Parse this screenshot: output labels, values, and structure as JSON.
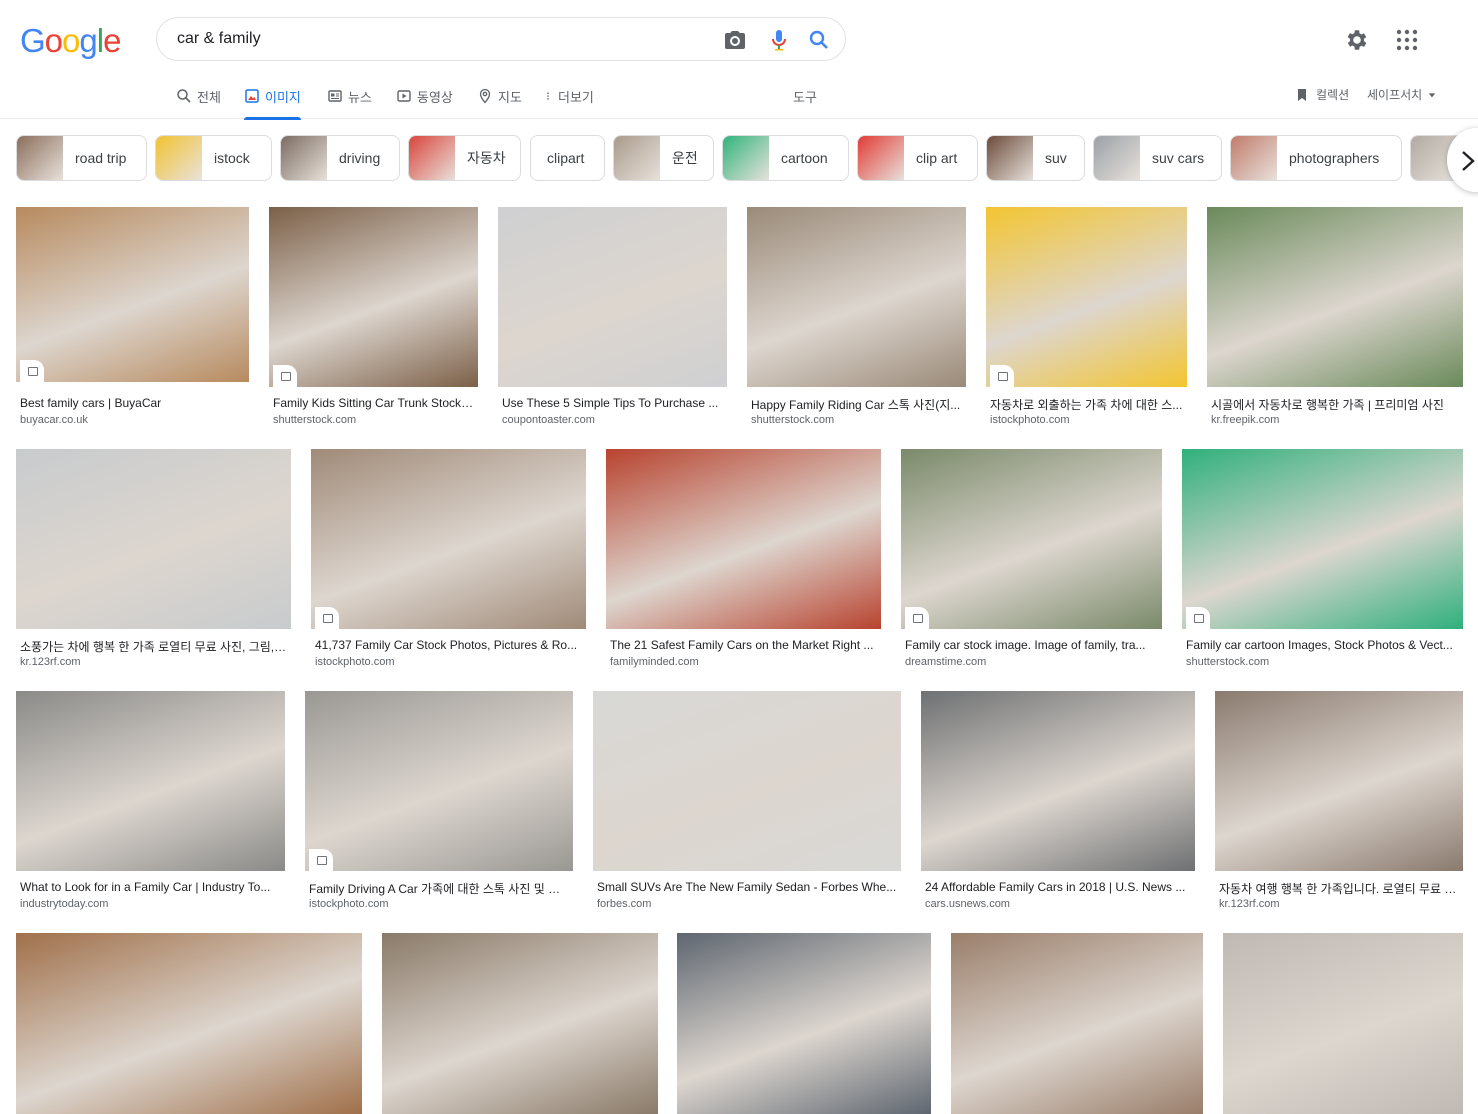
{
  "logo": {
    "g1": "G",
    "o1": "o",
    "o2": "o",
    "g2": "g",
    "l": "l",
    "e": "e"
  },
  "search": {
    "query": "car & family"
  },
  "tabs": [
    {
      "label": "전체",
      "icon": "search-icon"
    },
    {
      "label": "이미지",
      "icon": "image-icon",
      "active": true
    },
    {
      "label": "뉴스",
      "icon": "news-icon"
    },
    {
      "label": "동영상",
      "icon": "video-icon"
    },
    {
      "label": "지도",
      "icon": "map-pin-icon"
    },
    {
      "label": "더보기",
      "icon": "more-vert-icon"
    },
    {
      "label": "도구",
      "icon": ""
    }
  ],
  "right": {
    "collections": "컬렉션",
    "safesearch": "세이프서치"
  },
  "chips": [
    {
      "label": "road trip",
      "thumb": "#8a6d5a"
    },
    {
      "label": "istock",
      "thumb": "#f2c230"
    },
    {
      "label": "driving",
      "thumb": "#7a6a5e"
    },
    {
      "label": "자동차",
      "thumb": "#d8443a"
    },
    {
      "label": "clipart",
      "thumb": ""
    },
    {
      "label": "운전",
      "thumb": "#a89a8a"
    },
    {
      "label": "cartoon",
      "thumb": "#2fb37a"
    },
    {
      "label": "clip art",
      "thumb": "#e23a34"
    },
    {
      "label": "suv",
      "thumb": "#6a4a3a"
    },
    {
      "label": "suv cars",
      "thumb": "#9aa0a6"
    },
    {
      "label": "photographers",
      "thumb": "#c07a6a"
    },
    {
      "label": "",
      "thumb": "#b0a8a0"
    }
  ],
  "results": [
    {
      "title": "Best family cars | BuyaCar",
      "source": "buyacar.co.uk",
      "color": "#b78a5e"
    },
    {
      "title": "Family Kids Sitting Car Trunk Stock ...",
      "source": "shutterstock.com",
      "color": "#7c6048"
    },
    {
      "title": "Use These 5 Simple Tips To Purchase ...",
      "source": "coupontoaster.com",
      "color": "#cfd0d2"
    },
    {
      "title": "Happy Family Riding Car 스톡 사진(지...",
      "source": "shutterstock.com",
      "color": "#9a8a78"
    },
    {
      "title": "자동차로 외출하는 가족 차에 대한 스...",
      "source": "istockphoto.com",
      "color": "#f3c530"
    },
    {
      "title": "시골에서 자동차로 행복한 가족 | 프리미엄 사진",
      "source": "kr.freepik.com",
      "color": "#6a8a5a"
    },
    {
      "title": "소풍가는 차에 행복 한 가족 로열티 무료 사진, 그림, 이...",
      "source": "kr.123rf.com",
      "color": "#c8cbcd"
    },
    {
      "title": "41,737 Family Car Stock Photos, Pictures & Ro...",
      "source": "istockphoto.com",
      "color": "#a08a78"
    },
    {
      "title": "The 21 Safest Family Cars on the Market Right ...",
      "source": "familyminded.com",
      "color": "#b8432f"
    },
    {
      "title": "Family car stock image. Image of family, tra...",
      "source": "dreamstime.com",
      "color": "#7a8a6a"
    },
    {
      "title": "Family car cartoon Images, Stock Photos & Vect...",
      "source": "shutterstock.com",
      "color": "#2fb07c"
    },
    {
      "title": "What to Look for in a Family Car | Industry To...",
      "source": "industrytoday.com",
      "color": "#8a8a88"
    },
    {
      "title": "Family Driving A Car 가족에 대한 스톡 사진 및 기...",
      "source": "istockphoto.com",
      "color": "#9a9894"
    },
    {
      "title": "Small SUVs Are The New Family Sedan - Forbes Whe...",
      "source": "forbes.com",
      "color": "#d8d8d6"
    },
    {
      "title": "24 Affordable Family Cars in 2018 | U.S. News ...",
      "source": "cars.usnews.com",
      "color": "#6e7072"
    },
    {
      "title": "자동차 여행 행복 한 가족입니다. 로열티 무료 사...",
      "source": "kr.123rf.com",
      "color": "#8a7a6e"
    },
    {
      "title": "",
      "source": "",
      "color": "#a0704a"
    },
    {
      "title": "",
      "source": "",
      "color": "#8a7a68"
    },
    {
      "title": "",
      "source": "",
      "color": "#5e6670"
    },
    {
      "title": "",
      "source": "",
      "color": "#9a7e6a"
    },
    {
      "title": "",
      "source": "",
      "color": "#c0b8b2"
    }
  ]
}
